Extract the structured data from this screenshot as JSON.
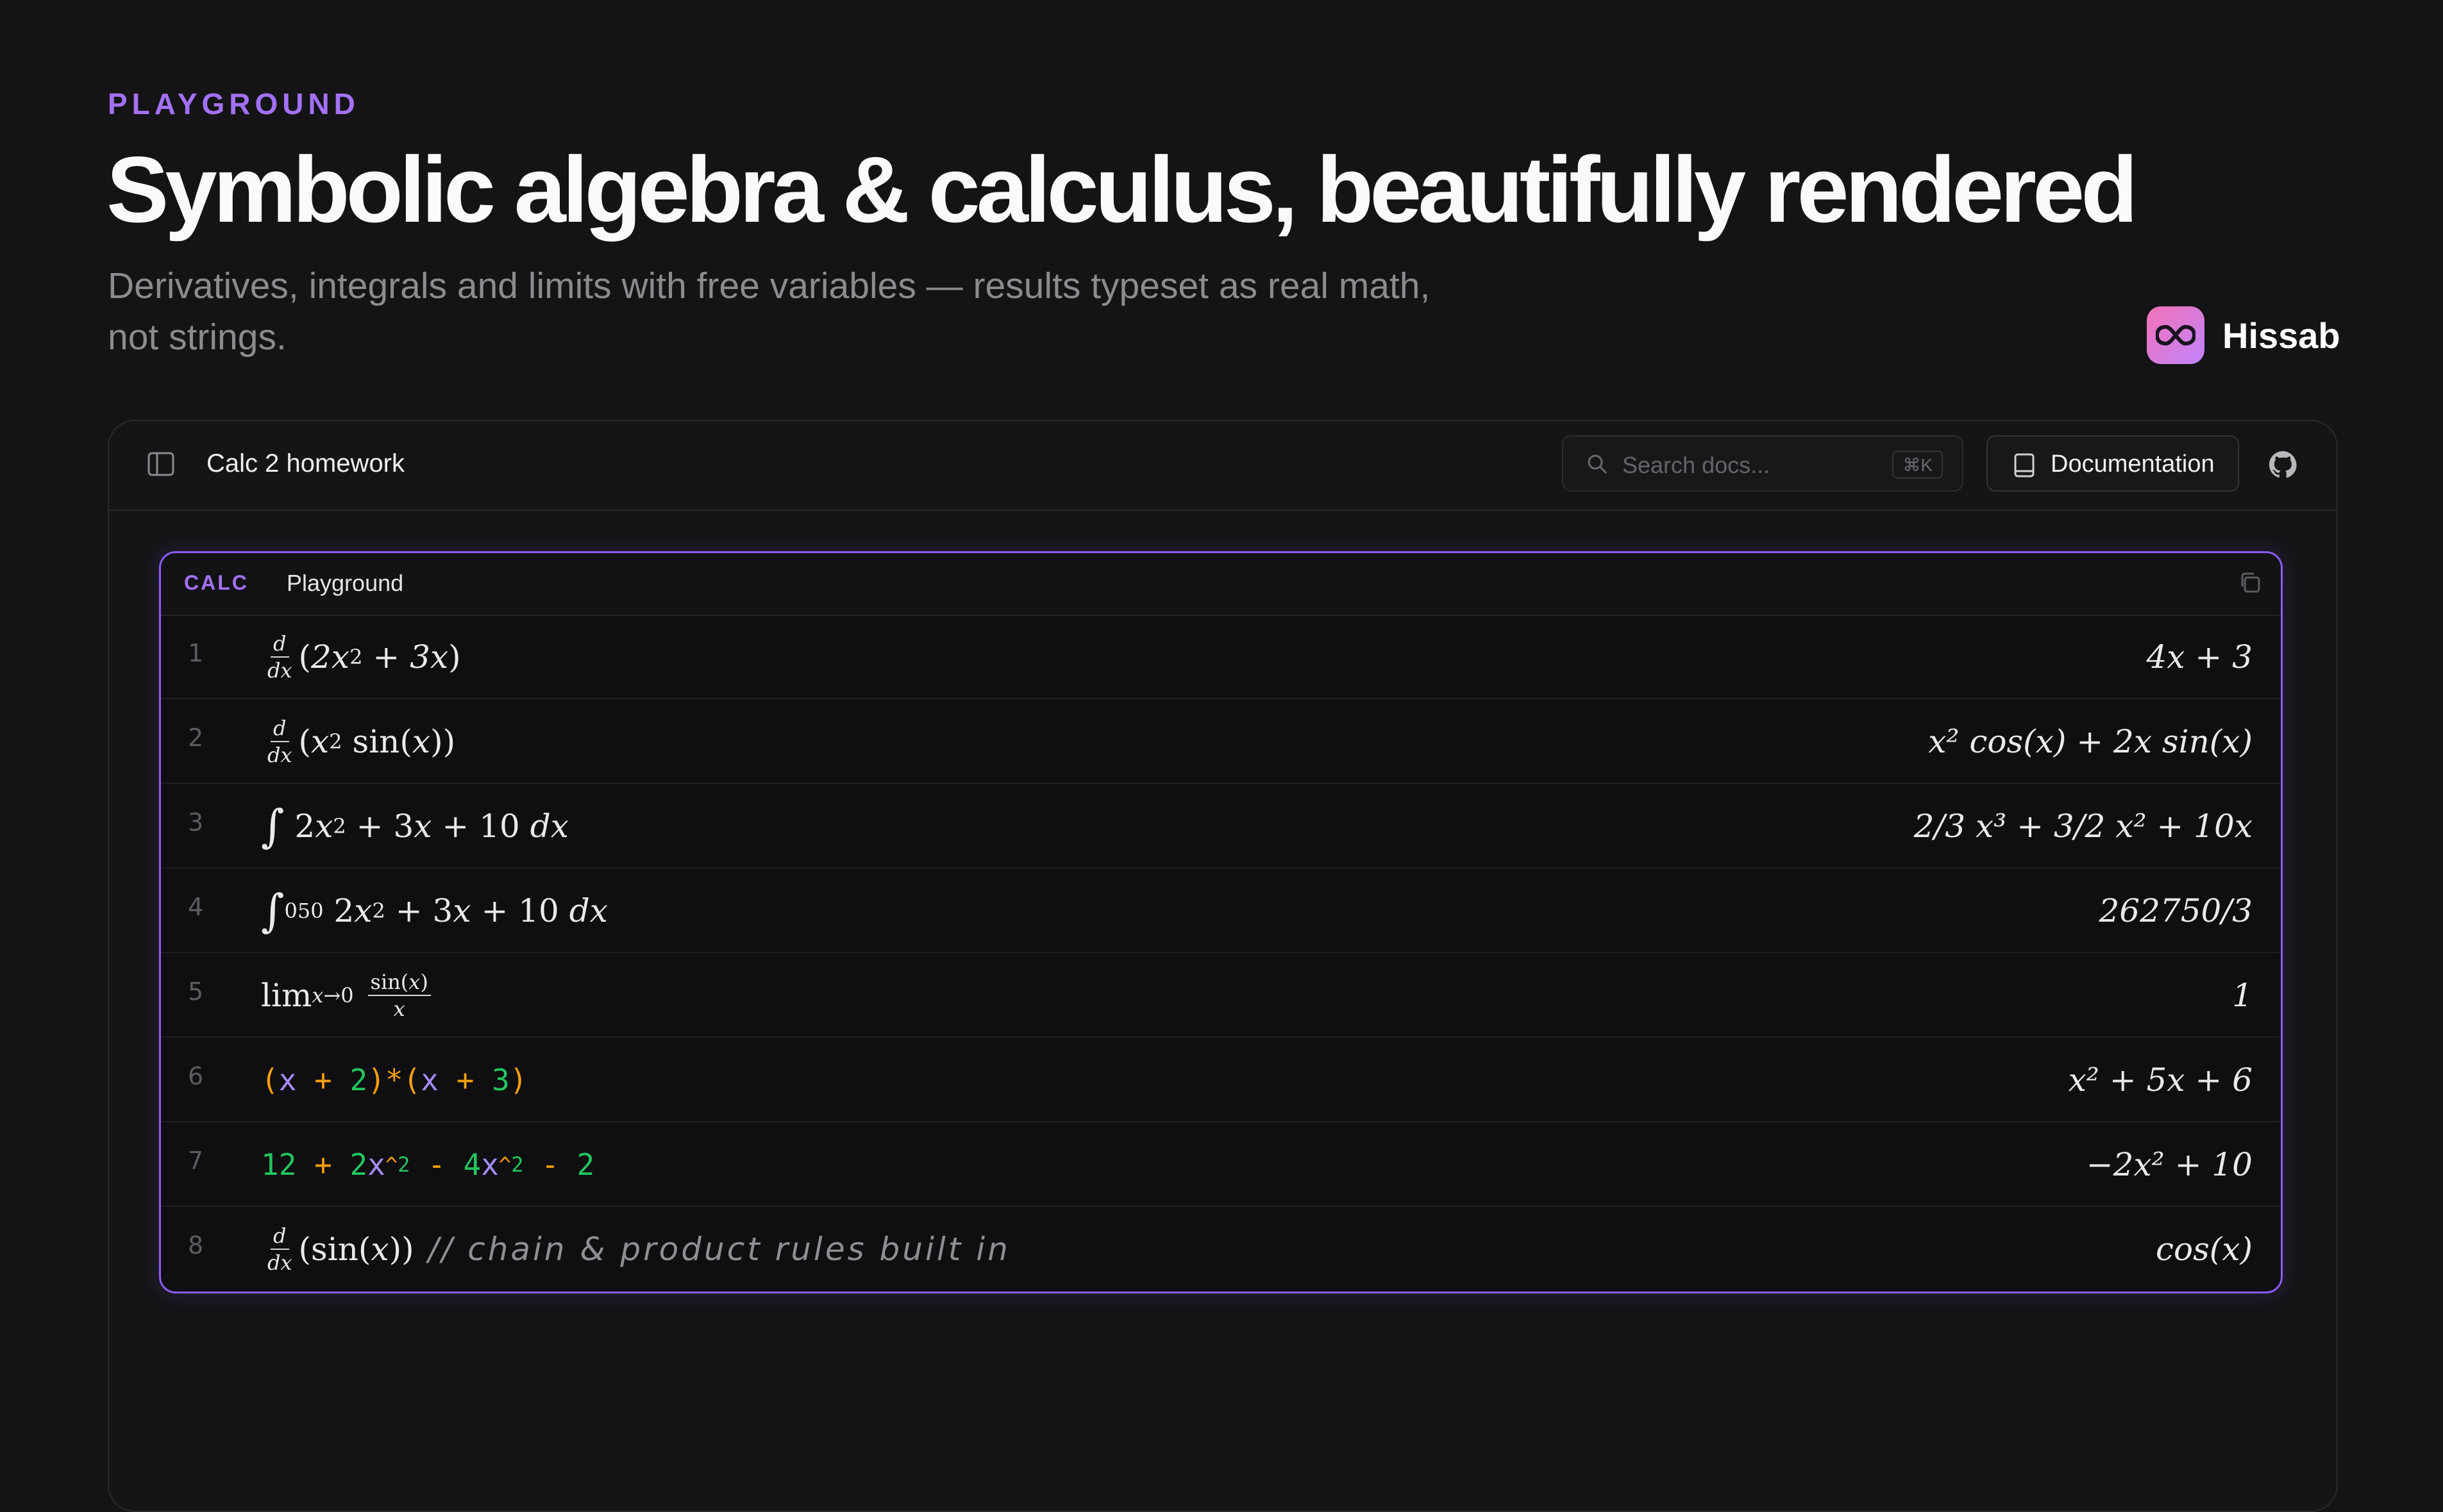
{
  "hero": {
    "eyebrow": "PLAYGROUND",
    "title": "Symbolic algebra & calculus, beautifully rendered",
    "subtitle": "Derivatives, integrals and limits with free variables — results typeset as real math, not strings."
  },
  "brand": {
    "name": "Hissab",
    "logo_icon": "infinity-icon"
  },
  "topbar": {
    "doc_title": "Calc 2 homework",
    "search_placeholder": "Search docs...",
    "search_shortcut": "⌘K",
    "docs_button": "Documentation",
    "github_icon": "github-icon"
  },
  "panel": {
    "tag": "CALC",
    "name": "Playground",
    "rows": [
      {
        "line": "1",
        "result": "4x + 3"
      },
      {
        "line": "2",
        "result": "x² cos(x) + 2x sin(x)"
      },
      {
        "line": "3",
        "result": "2/3 x³ + 3/2 x² + 10x"
      },
      {
        "line": "4",
        "result": "262750/3"
      },
      {
        "line": "5",
        "result": "1"
      },
      {
        "line": "6",
        "result": "x² + 5x + 6"
      },
      {
        "line": "7",
        "result": "−2x² + 10"
      },
      {
        "line": "8",
        "result": "cos(x)",
        "comment": "// chain & product rules built in"
      }
    ]
  },
  "colors": {
    "accent": "#a371f7",
    "operator": "#f59e0b",
    "number": "#22c55e",
    "variable": "#a78bfa"
  }
}
